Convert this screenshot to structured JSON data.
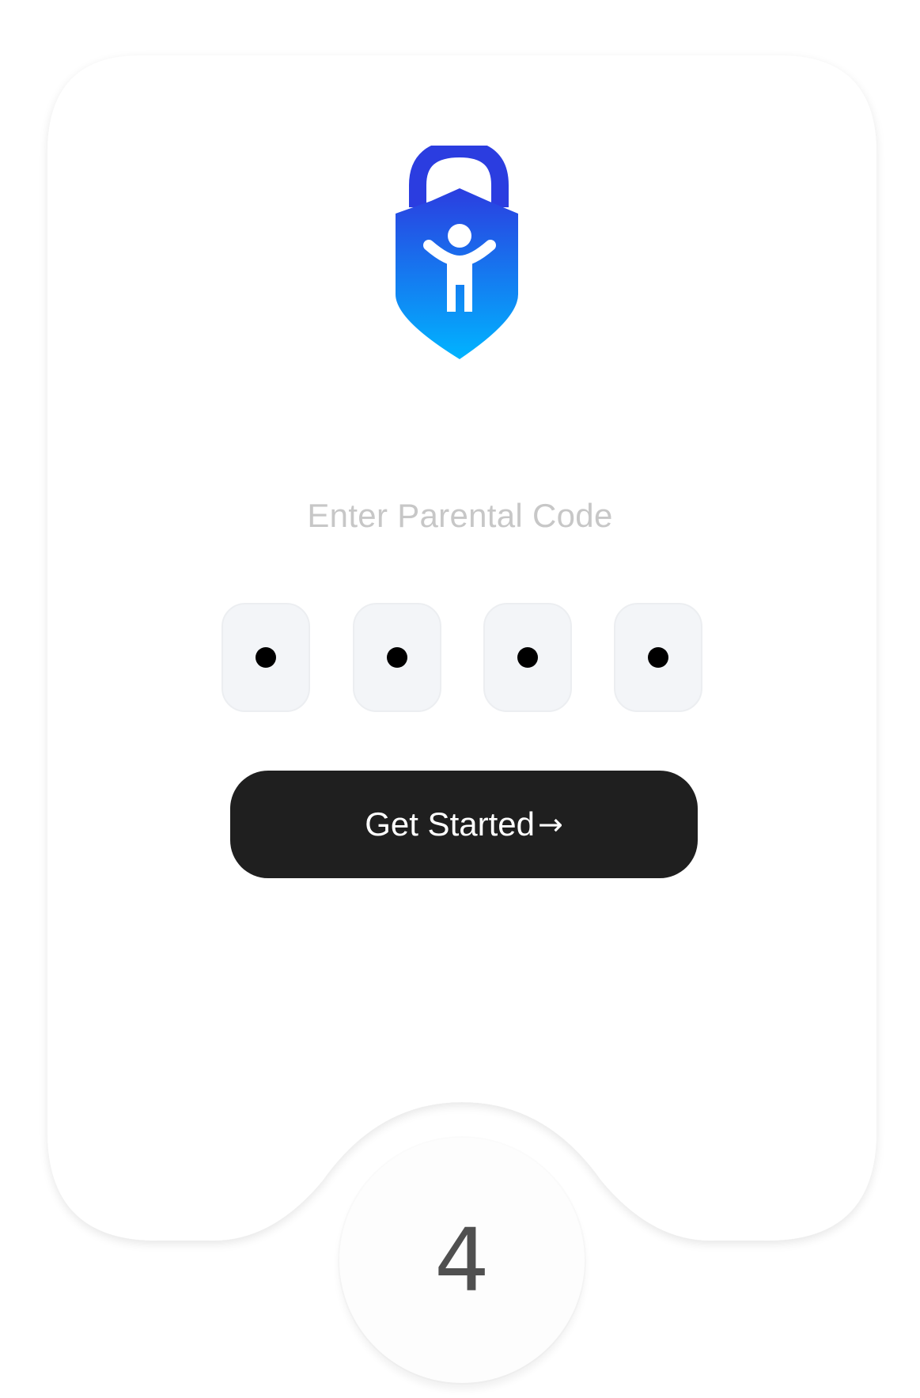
{
  "logo": {
    "icon": "child-lock-shield-icon",
    "gradient_top": "#2b3de0",
    "gradient_bottom": "#00b4ff"
  },
  "prompt": "Enter Parental Code",
  "code": {
    "digits_entered": 4,
    "mask_glyph": "dot"
  },
  "cta": {
    "label": "Get Started",
    "arrow": "→",
    "background": "#1f1f1f"
  },
  "step": {
    "number": "4"
  }
}
